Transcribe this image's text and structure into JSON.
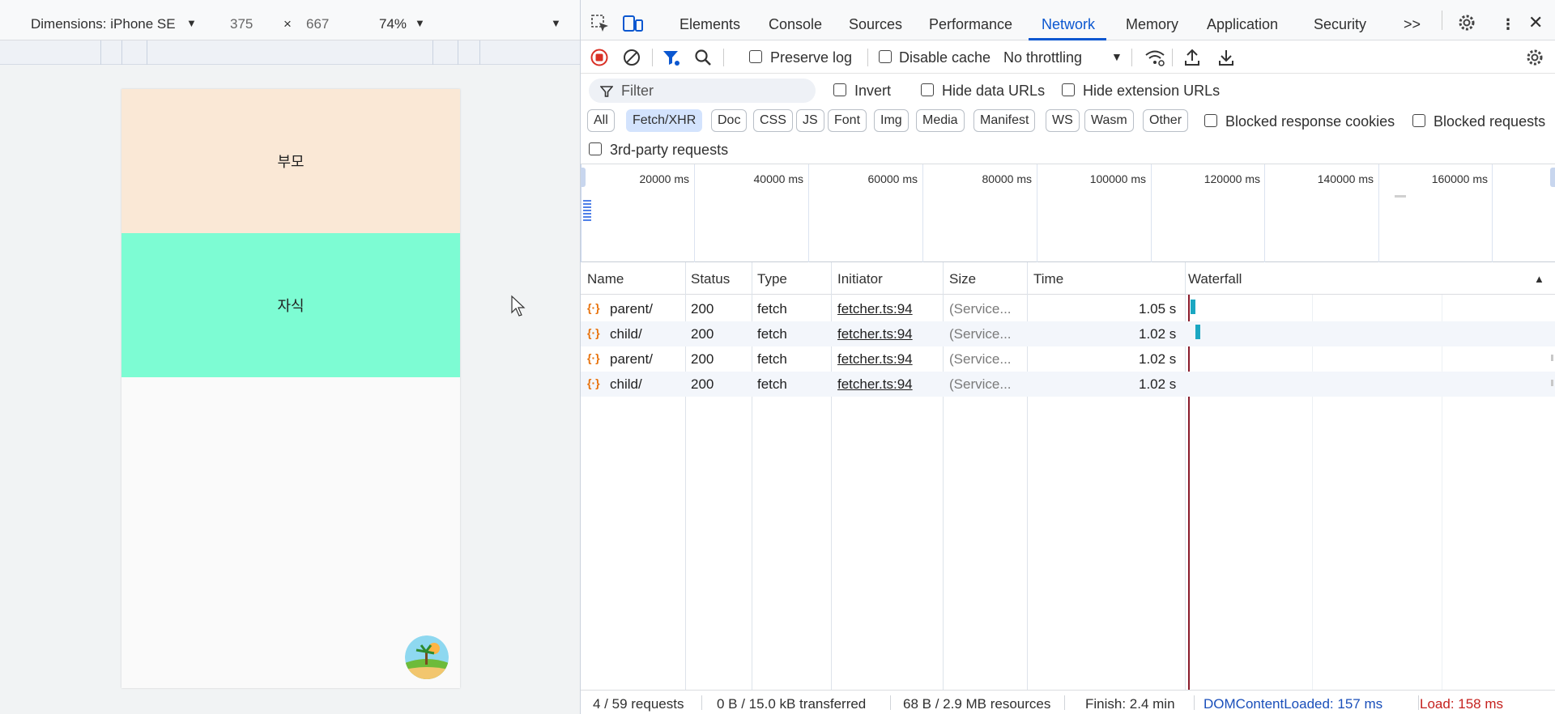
{
  "device_toolbar": {
    "dimensions_label": "Dimensions: iPhone SE",
    "width": "375",
    "times": "×",
    "height": "667",
    "zoom": "74%"
  },
  "page": {
    "parent_text": "부모",
    "child_text": "자식"
  },
  "devtools": {
    "tabs": [
      "Elements",
      "Console",
      "Sources",
      "Performance",
      "Network",
      "Memory",
      "Application",
      "Security"
    ],
    "active_tab": "Network",
    "more_tabs": ">>"
  },
  "toolbar": {
    "preserve_log": "Preserve log",
    "disable_cache": "Disable cache",
    "throttling": "No throttling"
  },
  "filters": {
    "placeholder": "Filter",
    "invert": "Invert",
    "hide_data_urls": "Hide data URLs",
    "hide_extension_urls": "Hide extension URLs",
    "types": [
      "All",
      "Fetch/XHR",
      "Doc",
      "CSS",
      "JS",
      "Font",
      "Img",
      "Media",
      "Manifest",
      "WS",
      "Wasm",
      "Other"
    ],
    "selected_type": "Fetch/XHR",
    "blocked_response_cookies": "Blocked response cookies",
    "blocked_requests": "Blocked requests",
    "third_party": "3rd-party requests"
  },
  "overview": {
    "ticks": [
      "20000 ms",
      "40000 ms",
      "60000 ms",
      "80000 ms",
      "100000 ms",
      "120000 ms",
      "140000 ms",
      "160000 ms"
    ]
  },
  "table": {
    "headers": {
      "name": "Name",
      "status": "Status",
      "type": "Type",
      "initiator": "Initiator",
      "size": "Size",
      "time": "Time",
      "waterfall": "Waterfall"
    },
    "rows": [
      {
        "name": "parent/",
        "status": "200",
        "type": "fetch",
        "initiator": "fetcher.ts:94",
        "size": "(Service...",
        "time": "1.05 s"
      },
      {
        "name": "child/",
        "status": "200",
        "type": "fetch",
        "initiator": "fetcher.ts:94",
        "size": "(Service...",
        "time": "1.02 s"
      },
      {
        "name": "parent/",
        "status": "200",
        "type": "fetch",
        "initiator": "fetcher.ts:94",
        "size": "(Service...",
        "time": "1.02 s"
      },
      {
        "name": "child/",
        "status": "200",
        "type": "fetch",
        "initiator": "fetcher.ts:94",
        "size": "(Service...",
        "time": "1.02 s"
      }
    ]
  },
  "status": {
    "requests": "4 / 59 requests",
    "transferred": "0 B / 15.0 kB transferred",
    "resources": "68 B / 2.9 MB resources",
    "finish": "Finish: 2.4 min",
    "dom_content_loaded": "DOMContentLoaded: 157 ms",
    "load": "Load: 158 ms"
  },
  "colors": {
    "accent": "#0b57d0",
    "parent_bg": "#fae8d6",
    "child_bg": "#7dfcd3",
    "load": "#c5221f",
    "dcl": "#1a4fba"
  }
}
